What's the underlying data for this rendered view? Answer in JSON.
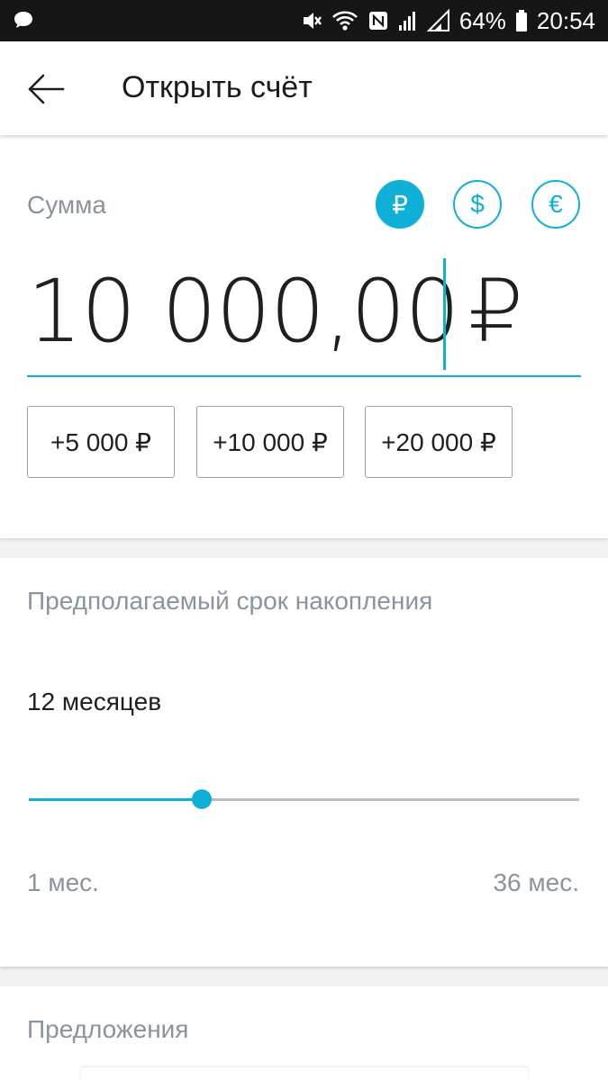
{
  "status_bar": {
    "battery": "64%",
    "time": "20:54",
    "icons": [
      "message-icon",
      "mute-icon",
      "wifi-icon",
      "nfc-icon",
      "signal-icon",
      "signal-icon",
      "battery-icon"
    ]
  },
  "app_bar": {
    "title": "Открыть счёт",
    "back_icon": "arrow-left-icon"
  },
  "amount_section": {
    "label": "Сумма",
    "currencies": [
      {
        "symbol": "₽",
        "selected": true
      },
      {
        "symbol": "$",
        "selected": false
      },
      {
        "symbol": "€",
        "selected": false
      }
    ],
    "value": "10 000,00",
    "currency_symbol": "₽",
    "quick_add": [
      "+5 000 ₽",
      "+10 000 ₽",
      "+20 000 ₽"
    ]
  },
  "term_section": {
    "label": "Предполагаемый срок накопления",
    "selected_text": "12 месяцев",
    "slider": {
      "min": 1,
      "max": 36,
      "value": 12
    },
    "min_label": "1 мес.",
    "max_label": "36 мес."
  },
  "offers_section": {
    "label": "Предложения"
  },
  "colors": {
    "accent": "#0fb0d8",
    "muted_text": "#8a94a0",
    "status_bar": "#161616"
  }
}
